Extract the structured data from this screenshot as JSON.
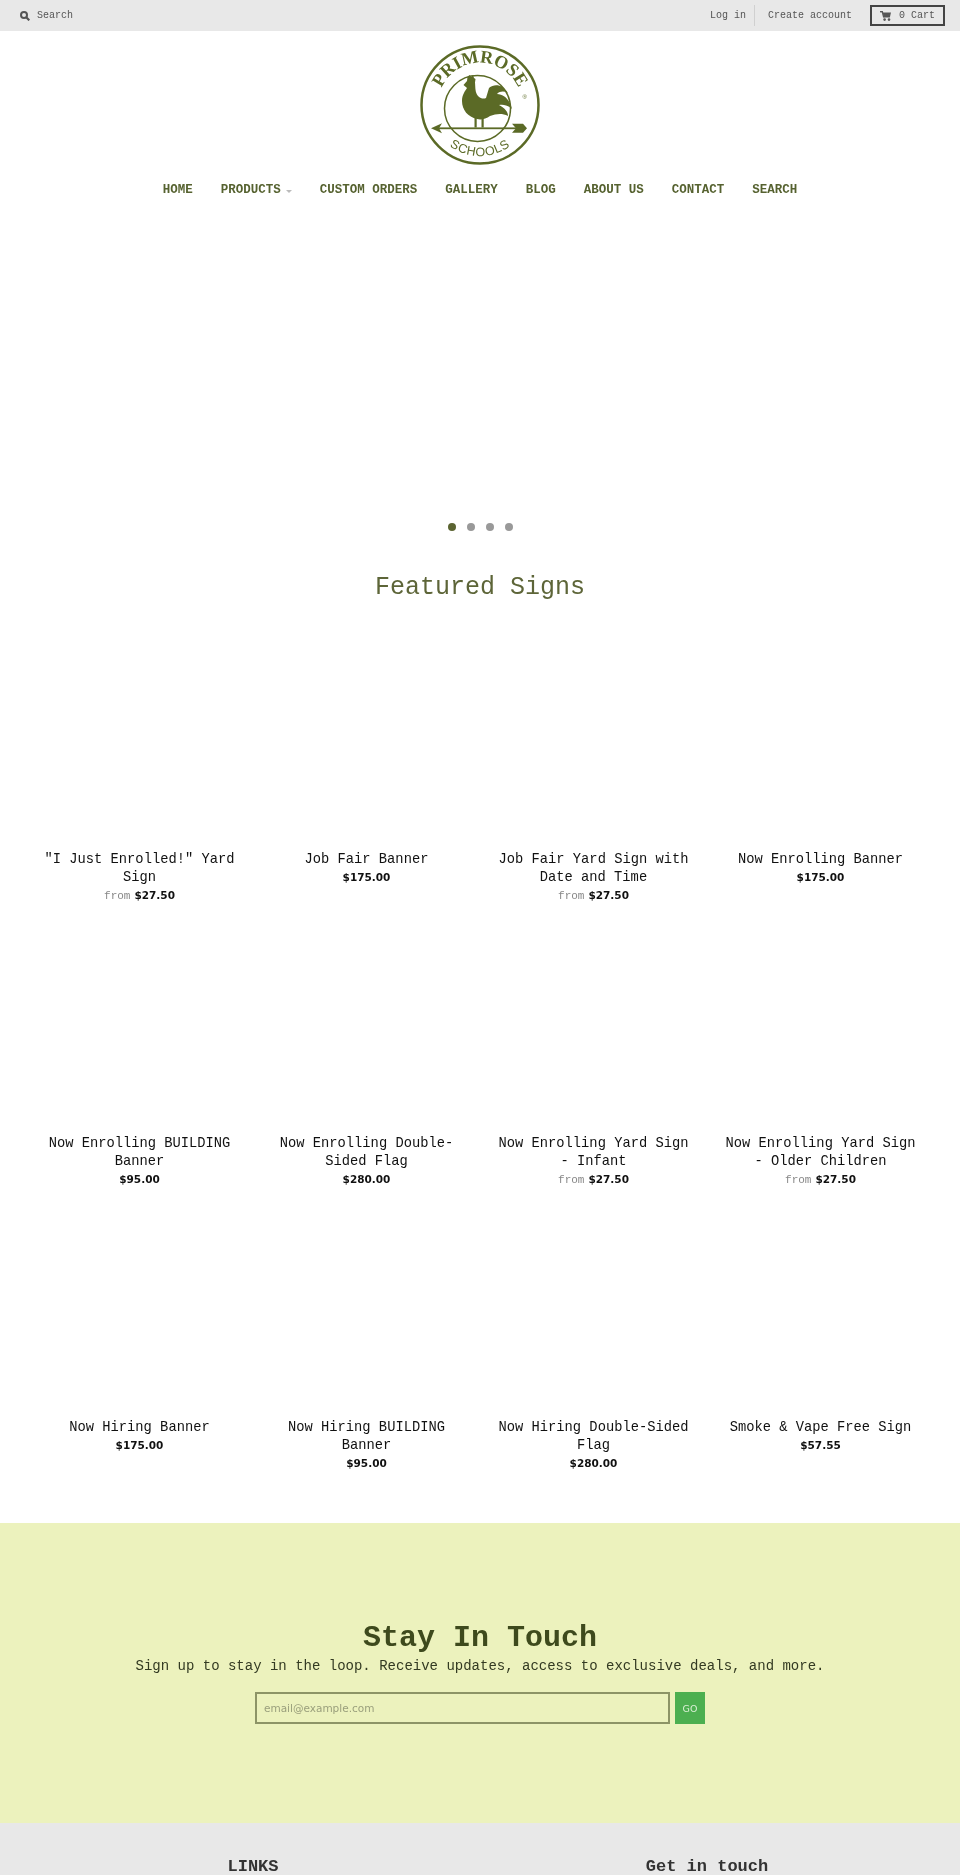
{
  "top_bar": {
    "search": {
      "placeholder": "Search"
    },
    "links": [
      "Log in",
      "Create account"
    ],
    "cart": {
      "count": "0",
      "label": "Cart"
    }
  },
  "logo": {
    "wordmark": "PRIMROSE",
    "mark": "®",
    "subtitle": "SCHOOLS"
  },
  "nav": [
    {
      "label": "HOME",
      "dropdown": false
    },
    {
      "label": "PRODUCTS",
      "dropdown": true
    },
    {
      "label": "CUSTOM ORDERS",
      "dropdown": false
    },
    {
      "label": "GALLERY",
      "dropdown": false
    },
    {
      "label": "BLOG",
      "dropdown": false
    },
    {
      "label": "ABOUT US",
      "dropdown": false
    },
    {
      "label": "CONTACT",
      "dropdown": false
    },
    {
      "label": "SEARCH",
      "dropdown": false
    }
  ],
  "slideshow": {
    "dots": [
      {
        "selected": true
      },
      {
        "selected": false
      },
      {
        "selected": false
      },
      {
        "selected": false
      }
    ]
  },
  "featured": {
    "title": "Featured Signs",
    "products": [
      {
        "title": "\"I Just Enrolled!\" Yard Sign",
        "price_prefix": "from",
        "price": "$27.50"
      },
      {
        "title": "Job Fair Banner",
        "price": "$175.00"
      },
      {
        "title": "Job Fair Yard Sign with Date and Time",
        "price_prefix": "from",
        "price": "$27.50"
      },
      {
        "title": "Now Enrolling Banner",
        "price": "$175.00"
      },
      {
        "title": "Now Enrolling BUILDING Banner",
        "price": "$95.00"
      },
      {
        "title": "Now Enrolling Double-Sided Flag",
        "price": "$280.00"
      },
      {
        "title": "Now Enrolling Yard Sign - Infant",
        "price_prefix": "from",
        "price": "$27.50"
      },
      {
        "title": "Now Enrolling Yard Sign - Older Children",
        "price_prefix": "from",
        "price": "$27.50"
      },
      {
        "title": "Now Hiring Banner",
        "price": "$175.00"
      },
      {
        "title": "Now Hiring BUILDING Banner",
        "price": "$95.00"
      },
      {
        "title": "Now Hiring Double-Sided Flag",
        "price": "$280.00"
      },
      {
        "title": "Smoke & Vape Free Sign",
        "price": "$57.55"
      }
    ]
  },
  "newsletter": {
    "title": "Stay In Touch",
    "text": "Sign up to stay in the loop. Receive updates, access to exclusive deals, and more.",
    "email": {
      "placeholder": "email@example.com"
    },
    "button": "GO"
  },
  "footer": {
    "headings": [
      "LINKS",
      "Get in touch"
    ]
  }
}
